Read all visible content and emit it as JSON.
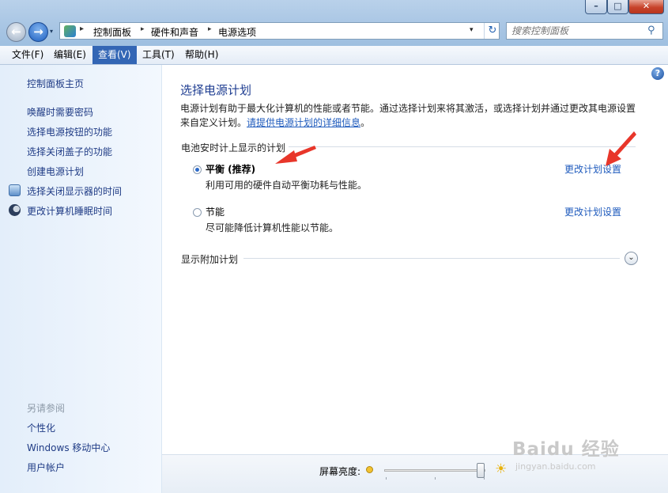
{
  "window": {
    "minimize": "–",
    "maximize": "□",
    "close": "✕"
  },
  "nav": {
    "back": "←",
    "forward": "→",
    "dropdown": "▾"
  },
  "address": {
    "crumbs": [
      "控制面板",
      "硬件和声音",
      "电源选项"
    ],
    "separator": "▸",
    "dropdown": "▾",
    "refresh": "↻"
  },
  "search": {
    "placeholder": "搜索控制面板",
    "icon": "search-icon"
  },
  "menubar": {
    "items": [
      "文件(F)",
      "编辑(E)",
      "查看(V)",
      "工具(T)",
      "帮助(H)"
    ],
    "active_index": 2
  },
  "sidebar": {
    "home": "控制面板主页",
    "links": [
      "唤醒时需要密码",
      "选择电源按钮的功能",
      "选择关闭盖子的功能",
      "创建电源计划",
      "选择关闭显示器的时间",
      "更改计算机睡眠时间"
    ],
    "icon_links": {
      "display": "monitor-icon",
      "sleep": "moon-icon"
    },
    "see_also_title": "另请参阅",
    "see_also": [
      "个性化",
      "Windows 移动中心",
      "用户帐户"
    ]
  },
  "main": {
    "help": "?",
    "title": "选择电源计划",
    "description": "电源计划有助于最大化计算机的性能或者节能。通过选择计划来将其激活，或选择计划并通过更改其电源设置来自定义计划。",
    "description_link": "请提供电源计划的详细信息",
    "group_label": "电池安时计上显示的计划",
    "plans": [
      {
        "name": "平衡 (推荐)",
        "desc": "利用可用的硬件自动平衡功耗与性能。",
        "link": "更改计划设置",
        "selected": true
      },
      {
        "name": "节能",
        "desc": "尽可能降低计算机性能以节能。",
        "link": "更改计划设置",
        "selected": false
      }
    ],
    "more_plans": "显示附加计划",
    "expand": "⌄"
  },
  "bottom": {
    "brightness_label": "屏幕亮度:",
    "brightness_value": 0.95,
    "sun_big": "☀"
  },
  "watermark": {
    "main": "Baidu 经验",
    "sub": "jingyan.baidu.com"
  },
  "colors": {
    "link": "#1f5bbd",
    "title": "#1e3d91",
    "menu_active": "#3366b5",
    "annotation_arrow": "#e8362a"
  }
}
